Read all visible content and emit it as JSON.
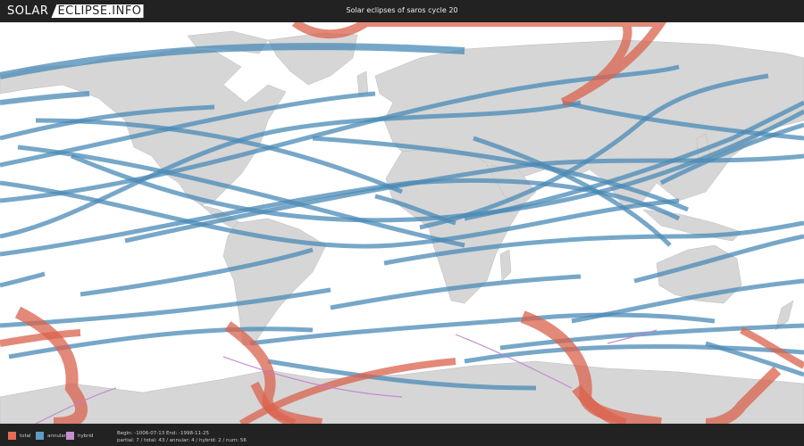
{
  "header": {
    "logo_left": "SOLAR",
    "logo_right": "ECLIPSE.INFO",
    "title": "Solar eclipses of saros cycle 20"
  },
  "colors": {
    "total": "#d9614c",
    "annular": "#4a8ab5",
    "hybrid": "#c180cf",
    "land": "#d6d6d6",
    "ocean": "#ffffff"
  },
  "legend": [
    {
      "key": "total",
      "label": "total",
      "color": "#e46c55"
    },
    {
      "key": "annular",
      "label": "annular",
      "color": "#5e9cc4"
    },
    {
      "key": "hybrid",
      "label": "hybrid",
      "color": "#c48fd0"
    }
  ],
  "footer": {
    "line1": "Begin: -1006-07-13 End: -1998-11-25",
    "line2": "partial: 7 / total: 43 / annular: 4 / hybrid: 2 / num: 56"
  }
}
